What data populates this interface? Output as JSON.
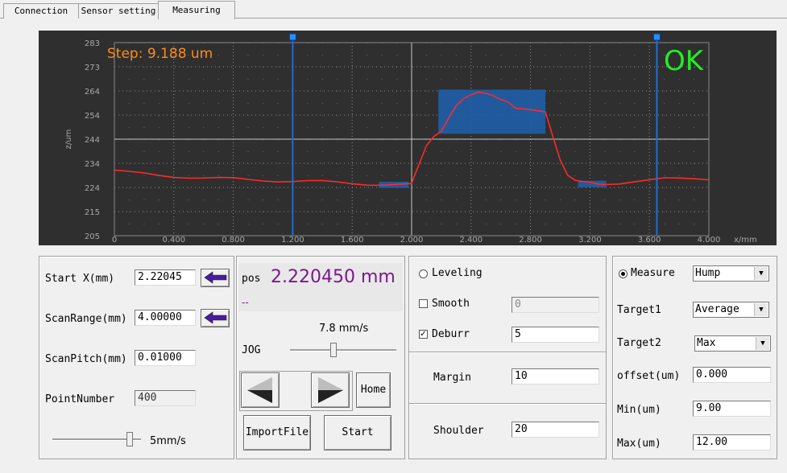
{
  "tabs": [
    {
      "label": "Connection"
    },
    {
      "label": "Sensor setting"
    },
    {
      "label": "Measuring"
    }
  ],
  "chart_data": {
    "type": "line",
    "step_text": "Step: 9.188 um",
    "status_text": "OK",
    "ylabel": "z/um",
    "xlabel": "x/mm",
    "xlim": [
      0,
      4.0
    ],
    "ylim": [
      205,
      283
    ],
    "x_ticks": [
      "0",
      "0.400",
      "0.800",
      "1.200",
      "1.600",
      "2.000",
      "2.400",
      "2.800",
      "3.200",
      "3.600",
      "4.000"
    ],
    "y_ticks": [
      "283",
      "273",
      "264",
      "254",
      "244",
      "234",
      "224",
      "215",
      "205"
    ],
    "cursors": [
      1.2,
      3.65
    ],
    "regions": [
      {
        "x0": 1.78,
        "x1": 1.98,
        "y0": 224.3,
        "y1": 226.8
      },
      {
        "x0": 2.18,
        "x1": 2.9,
        "y0": 246.2,
        "y1": 264.0
      },
      {
        "x0": 3.12,
        "x1": 3.31,
        "y0": 224.6,
        "y1": 227.2
      }
    ],
    "series": [
      {
        "color": "#ff2a2a",
        "x": [
          0,
          0.1,
          0.2,
          0.3,
          0.4,
          0.5,
          0.6,
          0.7,
          0.8,
          0.9,
          1.0,
          1.1,
          1.2,
          1.3,
          1.4,
          1.5,
          1.6,
          1.7,
          1.8,
          1.9,
          2.0,
          2.02,
          2.05,
          2.1,
          2.15,
          2.2,
          2.25,
          2.3,
          2.35,
          2.4,
          2.45,
          2.5,
          2.55,
          2.6,
          2.65,
          2.7,
          2.75,
          2.8,
          2.85,
          2.9,
          2.95,
          3.0,
          3.05,
          3.1,
          3.15,
          3.2,
          3.25,
          3.3,
          3.4,
          3.5,
          3.6,
          3.7,
          3.8,
          3.9,
          4.0
        ],
        "y": [
          231.5,
          230.5,
          229.8,
          229.3,
          229.0,
          228.8,
          228.4,
          228.1,
          227.9,
          227.6,
          227.5,
          227.3,
          227.1,
          226.9,
          226.7,
          226.5,
          226.3,
          226.0,
          225.7,
          225.5,
          225.5,
          229.0,
          234.0,
          242.0,
          245.5,
          247.0,
          252.0,
          257.0,
          260.5,
          262.5,
          263.5,
          262.5,
          261.0,
          259.5,
          259.0,
          257.0,
          256.8,
          256.0,
          255.0,
          254.5,
          245.0,
          236.0,
          230.0,
          227.5,
          226.5,
          226.0,
          225.7,
          226.0,
          226.5,
          227.0,
          227.3,
          227.8,
          228.0,
          228.3,
          228.2
        ]
      }
    ]
  },
  "left_panel": {
    "start_x_label": "Start X(mm)",
    "start_x_value": "2.22045",
    "scan_range_label": "ScanRange(mm)",
    "scan_range_value": "4.00000",
    "scan_pitch_label": "ScanPitch(mm)",
    "scan_pitch_value": "0.01000",
    "point_number_label": "PointNumber",
    "point_number_value": "400",
    "speed_label": "5mm/s",
    "speed_slider_value": 0.9
  },
  "jog_panel": {
    "pos_label": "pos",
    "pos_value": "2.220450 mm",
    "status_line": "--",
    "speed_text": "7.8 mm/s",
    "jog_label": "JOG",
    "jog_slider_value": 0.4,
    "home_label": "Home",
    "import_label": "ImportFile",
    "start_label": "Start"
  },
  "proc_panel": {
    "leveling_label": "Leveling",
    "leveling_checked": false,
    "smooth_label": "Smooth",
    "smooth_checked": false,
    "smooth_value": "0",
    "deburr_label": "Deburr",
    "deburr_checked": true,
    "deburr_value": "5",
    "margin_label": "Margin",
    "margin_value": "10",
    "shoulder_label": "Shoulder",
    "shoulder_value": "20"
  },
  "measure_panel": {
    "measure_label": "Measure",
    "measure_checked": true,
    "measure_value": "Hump",
    "target1_label": "Target1",
    "target1_value": "Average",
    "target2_label": "Target2",
    "target2_value": "Max",
    "offset_label": "offset(um)",
    "offset_value": "0.000",
    "min_label": "Min(um)",
    "min_value": "9.00",
    "max_label": "Max(um)",
    "max_value": "12.00"
  },
  "colors": {
    "plot_bg": "#2f2f2f",
    "grid": "#9a9a9a",
    "cursor": "#1e6fd0",
    "region": "#1f5fa8",
    "step_text": "#ff8c1a",
    "ok_text": "#22ee22",
    "pos_value": "#7a1a8a",
    "arrow": "#4a1aa0"
  }
}
